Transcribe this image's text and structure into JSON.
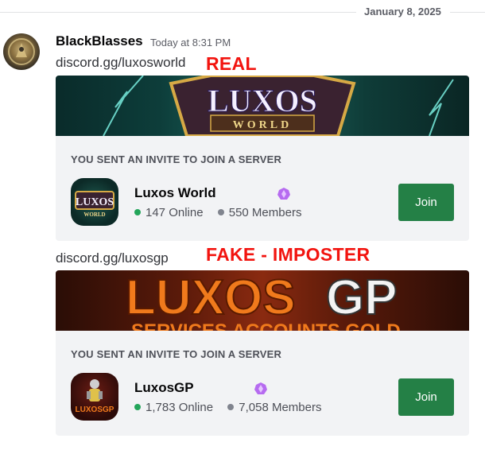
{
  "date_divider": "January 8, 2025",
  "message": {
    "username": "BlackBlasses",
    "timestamp": "Today at 8:31 PM"
  },
  "invites": [
    {
      "link": "discord.gg/luxosworld",
      "annotation": "REAL",
      "banner_text": "LUXOS",
      "banner_subtext": "WORLD",
      "header": "YOU SENT AN INVITE TO JOIN A SERVER",
      "server_name": "Luxos World",
      "icon_text": "LUXOS",
      "icon_subtext": "WORLD",
      "online": "147 Online",
      "members": "550 Members",
      "join_label": "Join"
    },
    {
      "link": "discord.gg/luxosgp",
      "annotation": "FAKE - IMPOSTER",
      "banner_text": "LUXOS",
      "banner_text2": "GP",
      "banner_subtext": "SERVICES  ACCOUNTS  GOLD",
      "header": "YOU SENT AN INVITE TO JOIN A SERVER",
      "server_name": "LuxosGP",
      "icon_text": "LUXOSGP",
      "online": "1,783 Online",
      "members": "7,058 Members",
      "join_label": "Join"
    }
  ],
  "colors": {
    "annotation": "#f2140f",
    "join_button": "#248046",
    "online_dot": "#23a55a",
    "boost_badge": "#b66bf0"
  }
}
